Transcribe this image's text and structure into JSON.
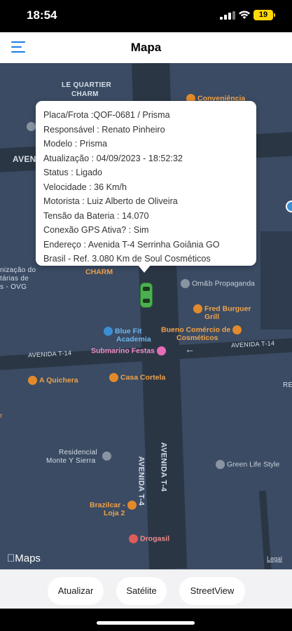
{
  "status_bar": {
    "time": "18:54",
    "battery": "19"
  },
  "nav": {
    "title": "Mapa"
  },
  "map": {
    "area_labels": {
      "le_quartier_1": "LE QUARTIER",
      "le_quartier_2": "CHARM",
      "avenida_left": "AVENIDA",
      "t14_left": "AVENIDA T-14",
      "t14_right": "AVENIDA T-14",
      "t4_a": "AVENIDA T-4",
      "t4_b": "AVENIDA T-4",
      "org_1": "nização do",
      "org_2": "tárias de",
      "org_3": "s - OVG",
      "residencial_1": "Residencial",
      "residencial_2": "Monte Y Sierra",
      "partial_right": "RE",
      "partial_bottom_left": "r"
    },
    "pois": {
      "conveniencia": "Conveniência",
      "charm_label": "CHARM",
      "omb": "Om&b Propaganda",
      "fred_1": "Fred Burguer",
      "fred_2": "Grill",
      "bluefit_1": "Blue Fit",
      "bluefit_2": "Academia",
      "bueno_1": "Bueno Comércio de",
      "bueno_2": "Cosméticos",
      "submarino": "Submarino Festas",
      "quichera": "A Quichera",
      "casa_cortela": "Casa Cortela",
      "green_life": "Green Life Style",
      "brazilcar_1": "Brazilcar -",
      "brazilcar_2": "Loja 2",
      "drogasil": "Drogasil"
    },
    "attribution": "Maps",
    "legal": "Legal"
  },
  "callout": {
    "lines": [
      "Placa/Frota :QOF-0681 / Prisma",
      "Responsável : Renato Pinheiro",
      "Modelo : Prisma",
      "Atualização : 04/09/2023 - 18:52:32",
      "Status : Ligado",
      "Velocidade : 36 Km/h",
      "Motorista : Luiz Alberto de Oliveira",
      "Tensão da Bateria : 14.070",
      "Conexão GPS Ativa? : Sim",
      "Endereço : Avenida T-4 Serrinha Goiânia GO",
      "Brasil - Ref. 3.080 Km de Soul Cosméticos"
    ]
  },
  "buttons": {
    "atualizar": "Atualizar",
    "satelite": "Satélite",
    "streetview": "StreetView"
  },
  "colors": {
    "accent": "#1c7ee0",
    "map_bg": "#3a4b63",
    "road": "#2b3645",
    "vehicle": "#4caf50",
    "poi_orange": "#f0a24a"
  }
}
